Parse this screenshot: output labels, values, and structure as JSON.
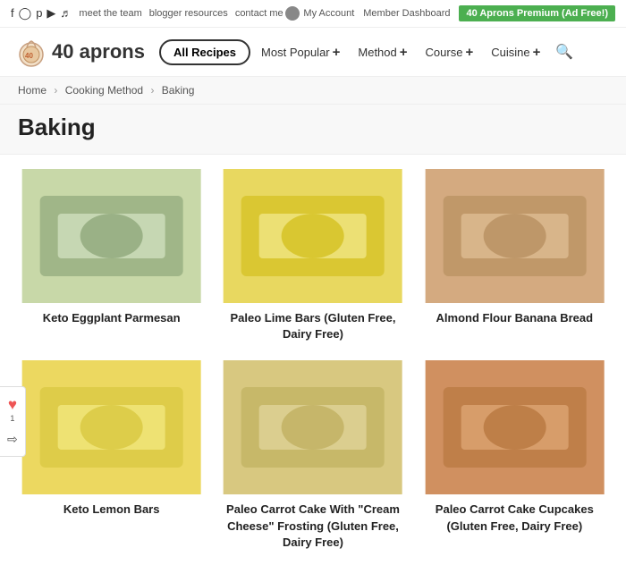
{
  "topbar": {
    "social_icons": [
      "f",
      "i",
      "p",
      "y",
      "t"
    ],
    "links": [
      "meet the team",
      "blogger resources",
      "contact me"
    ],
    "my_account": "My Account",
    "member_dashboard": "Member Dashboard",
    "premium_badge": "40 Aprons Premium (Ad Free!)"
  },
  "header": {
    "logo_text": "40 aprons",
    "nav_items": [
      {
        "label": "All Recipes",
        "type": "main"
      },
      {
        "label": "Most Popular",
        "has_plus": true
      },
      {
        "label": "Method",
        "has_plus": true
      },
      {
        "label": "Course",
        "has_plus": true
      },
      {
        "label": "Cuisine",
        "has_plus": true
      }
    ]
  },
  "breadcrumb": {
    "items": [
      "Home",
      "Cooking Method",
      "Baking"
    ]
  },
  "page": {
    "title": "Baking"
  },
  "recipes": [
    {
      "id": 1,
      "title": "Keto Eggplant Parmesan",
      "color": "#c8d8b0"
    },
    {
      "id": 2,
      "title": "Paleo Lime Bars (Gluten Free, Dairy Free)",
      "color": "#e8d870"
    },
    {
      "id": 3,
      "title": "Almond Flour Banana Bread",
      "color": "#d4b896"
    },
    {
      "id": 4,
      "title": "Keto Lemon Bars",
      "color": "#e8e060"
    },
    {
      "id": 5,
      "title": "Paleo Carrot Cake With \"Cream Cheese\" Frosting (Gluten Free, Dairy Free)",
      "color": "#d4c8a0"
    },
    {
      "id": 6,
      "title": "Paleo Carrot Cake Cupcakes (Gluten Free, Dairy Free)",
      "color": "#c8a870"
    }
  ],
  "floating_sidebar": {
    "heart_count": "1",
    "share_label": ""
  }
}
